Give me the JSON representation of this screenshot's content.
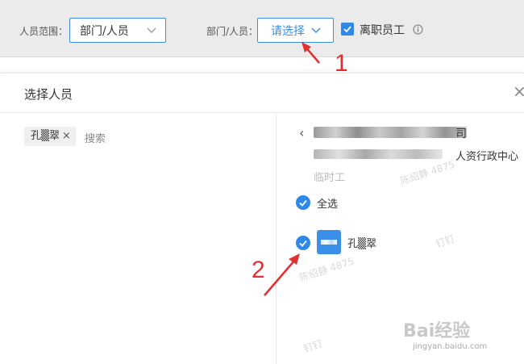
{
  "filter_bar": {
    "scope_label": "人员范围：",
    "scope_value": "部门/人员",
    "dept_label": "部门/人员：",
    "pick_button": "请选择",
    "resigned_label": "离职员工"
  },
  "dialog": {
    "title": "选择人员",
    "close": "×",
    "selected_tag": "孔▒翠",
    "tag_remove": "×",
    "search_placeholder": "搜索",
    "back": "‹",
    "company_suffix": "司",
    "dept_suffix": "人资行政中心",
    "group_label": "临时工",
    "select_all": "全选",
    "member_name": "孔▒翠"
  },
  "overlays": {
    "watermark_1": "陈绍静 4875",
    "watermark_2": "钉钉",
    "watermark_3": "陈绍静 4875",
    "watermark_4": "钉钉",
    "annotation_1": "1",
    "annotation_2": "2",
    "brand": "Bai经验",
    "brand_url": "jingyan.baidu.com"
  },
  "colors": {
    "accent": "#2f87e6",
    "annotation": "#e03030"
  }
}
